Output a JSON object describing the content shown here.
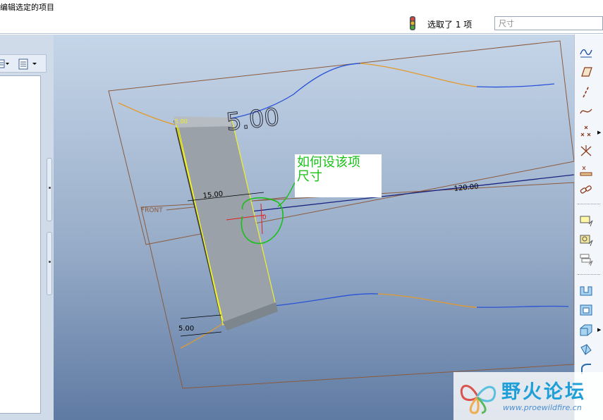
{
  "prompt": "编辑选定的项目",
  "status": {
    "selection_text": "选取了 1 项",
    "filter_placeholder": "尺寸"
  },
  "model": {
    "dimensions": {
      "top": "5.00",
      "top_small": "5.00",
      "width": "15.00",
      "length": "120.00",
      "bottom": "5.00",
      "center": "0"
    },
    "datum_label": "FRONT"
  },
  "callout": {
    "line1": "如何设该项",
    "line2": "尺寸"
  },
  "watermark": {
    "name": "野火论坛",
    "url": "www.proewildfire.cn"
  },
  "right_toolbar": {
    "icons": [
      "sketch-curve-icon",
      "datum-plane-icon",
      "datum-axis-icon",
      "datum-curve-icon",
      "datum-point-icon",
      "coordinate-system-icon",
      "analysis-icon",
      "datum-chain-icon",
      "layer-tool-icon-1",
      "layer-tool-icon-2",
      "layer-tool-icon-3",
      "extrude-icon",
      "shell-icon",
      "revolve-icon",
      "sweep-icon",
      "round-icon"
    ]
  },
  "colors": {
    "sketch_curve_blue": "#2a52d6",
    "sketch_curve_orange": "#e39a2b",
    "datum_plane_brown": "#8b5a3c",
    "highlight_yellow": "#f1f12a",
    "callout_green": "#19c019"
  }
}
